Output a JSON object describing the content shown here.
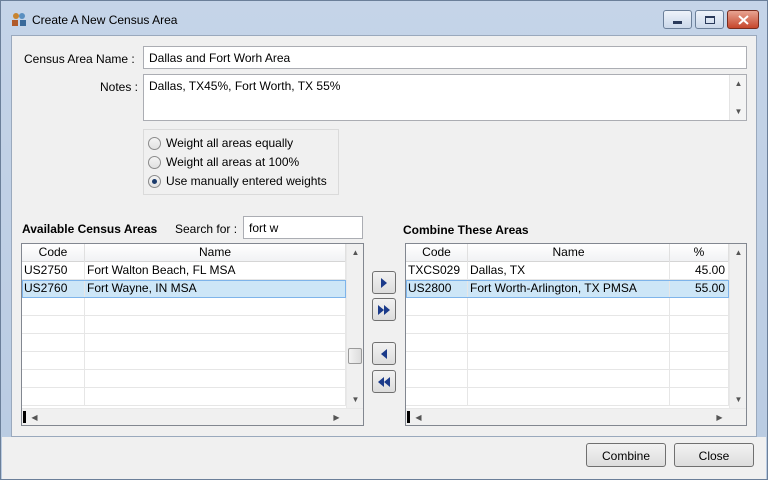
{
  "window": {
    "title": "Create A New Census Area"
  },
  "form": {
    "name_label": "Census Area Name :",
    "name_value": "Dallas and Fort Worh Area",
    "notes_label": "Notes :",
    "notes_value": "Dallas, TX45%, Fort Worth, TX 55%"
  },
  "weighting": {
    "options": [
      {
        "label": "Weight all areas equally",
        "selected": false
      },
      {
        "label": "Weight all areas at 100%",
        "selected": false
      },
      {
        "label": "Use manually entered weights",
        "selected": true
      }
    ]
  },
  "available": {
    "title": "Available Census Areas",
    "search_label": "Search for :",
    "search_value": "fort w",
    "columns": [
      "Code",
      "Name"
    ],
    "rows": [
      {
        "code": "US2750",
        "name": "Fort Walton Beach, FL MSA",
        "selected": false
      },
      {
        "code": "US2760",
        "name": "Fort Wayne, IN MSA",
        "selected": true
      }
    ]
  },
  "combine": {
    "title": "Combine These Areas",
    "columns": [
      "Code",
      "Name",
      "%"
    ],
    "rows": [
      {
        "code": "TXCS029",
        "name": "Dallas, TX",
        "pct": "45.00",
        "selected": false
      },
      {
        "code": "US2800",
        "name": "Fort Worth-Arlington, TX PMSA",
        "pct": "55.00",
        "selected": true
      }
    ]
  },
  "buttons": {
    "combine": "Combine",
    "close": "Close"
  },
  "colors": {
    "selection": "#cde6f7",
    "selection_border": "#7eb4ea",
    "arrow": "#1a3a8a"
  }
}
